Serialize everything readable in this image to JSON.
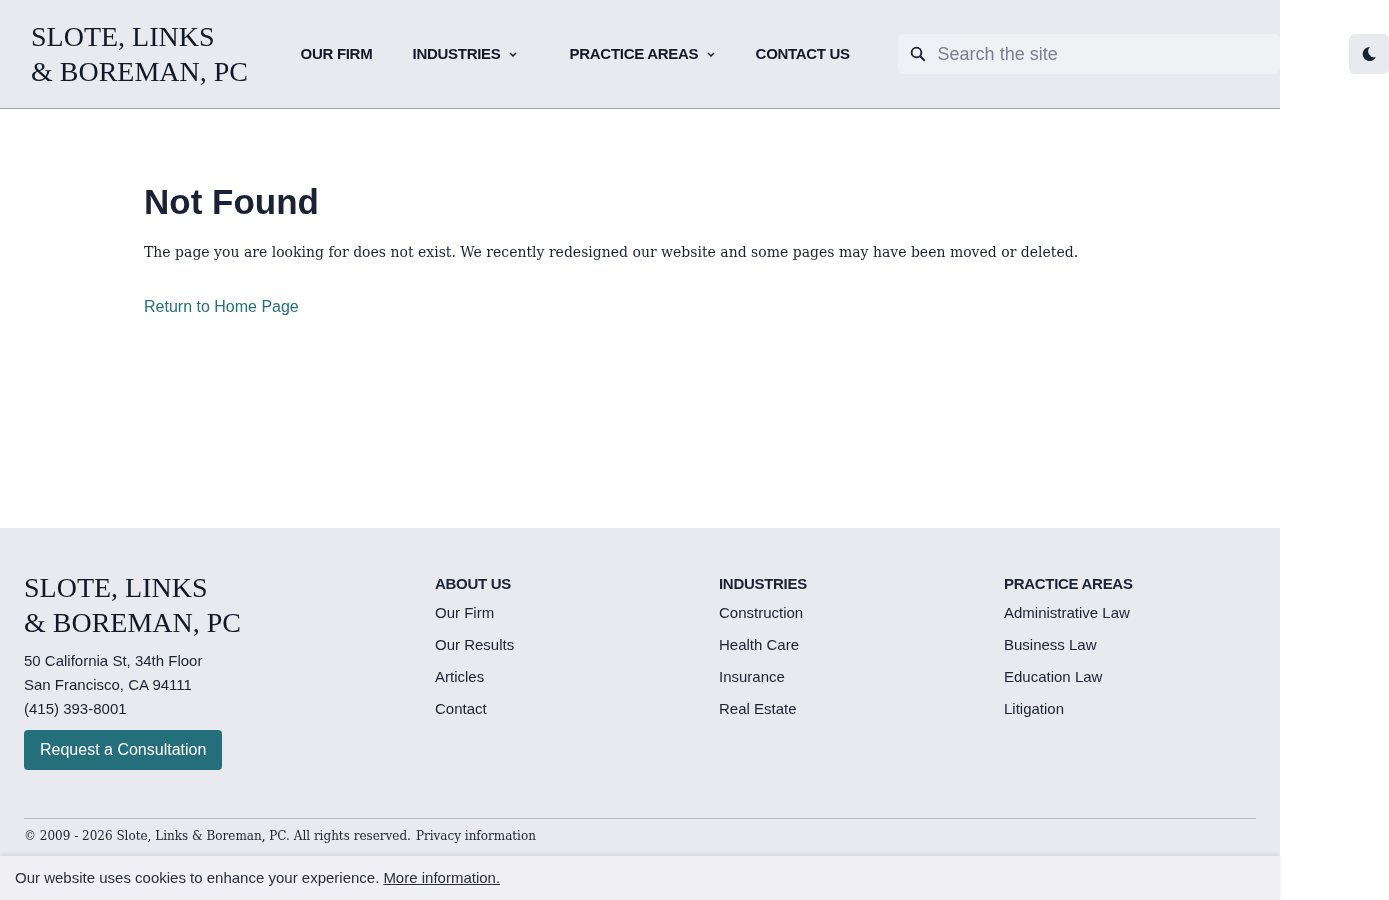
{
  "header": {
    "logo": [
      "SLOTE, LINKS",
      "& BOREMAN, PC"
    ],
    "nav": [
      {
        "label": "OUR FIRM",
        "dropdown": false
      },
      {
        "label": "INDUSTRIES",
        "dropdown": true
      },
      {
        "label": "PRACTICE AREAS",
        "dropdown": true
      },
      {
        "label": "CONTACT US",
        "dropdown": false
      }
    ],
    "search": {
      "placeholder": "Search the site"
    }
  },
  "main": {
    "title": "Not Found",
    "message": "The page you are looking for does not exist. We recently redesigned our website and some pages may have been moved or deleted.",
    "link": "Return to Home Page"
  },
  "footer": {
    "logo": [
      "SLOTE, LINKS",
      "& BOREMAN, PC"
    ],
    "address": [
      "50 California St, 34th Floor",
      "San Francisco, CA 94111",
      "(415) 393-8001"
    ],
    "button": "Request a Consultation",
    "columns": [
      {
        "heading": "ABOUT US",
        "links": [
          "Our Firm",
          "Our Results",
          "Articles",
          "Contact"
        ]
      },
      {
        "heading": "INDUSTRIES",
        "links": [
          "Construction",
          "Health Care",
          "Insurance",
          "Real Estate"
        ]
      },
      {
        "heading": "PRACTICE AREAS",
        "links": [
          "Administrative Law",
          "Business Law",
          "Education Law",
          "Litigation"
        ]
      }
    ],
    "copyright": "© 2009 - 2026 Slote, Links & Boreman, PC. All rights reserved.",
    "privacy": "Privacy information"
  },
  "cookie_banner": {
    "text": "Our website uses cookies to enhance your experience.",
    "link": "More information."
  }
}
